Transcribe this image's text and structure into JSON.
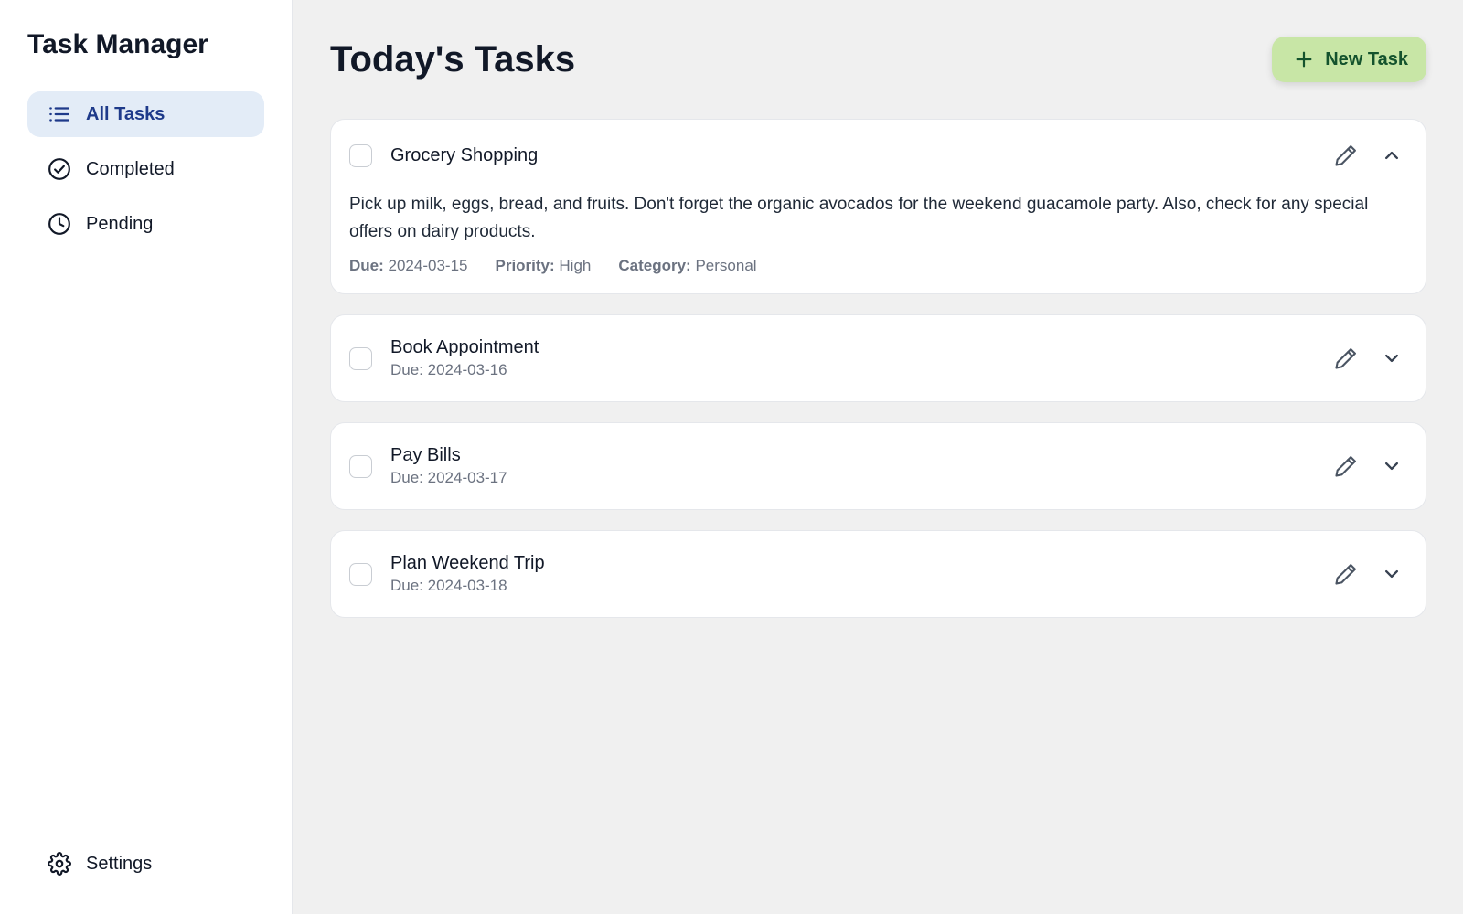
{
  "sidebar": {
    "title": "Task Manager",
    "nav": [
      {
        "label": "All Tasks",
        "icon": "list-icon",
        "active": true
      },
      {
        "label": "Completed",
        "icon": "check-circle-icon",
        "active": false
      },
      {
        "label": "Pending",
        "icon": "clock-icon",
        "active": false
      }
    ],
    "settings_label": "Settings"
  },
  "main": {
    "title": "Today's Tasks",
    "new_task_label": "New Task"
  },
  "tasks": [
    {
      "title": "Grocery Shopping",
      "expanded": true,
      "description": "Pick up milk, eggs, bread, and fruits. Don't forget the organic avocados for the weekend guacamole party. Also, check for any special offers on dairy products.",
      "due_label": "Due:",
      "due": "2024-03-15",
      "priority_label": "Priority:",
      "priority": "High",
      "category_label": "Category:",
      "category": "Personal"
    },
    {
      "title": "Book Appointment",
      "due_text": "Due: 2024-03-16"
    },
    {
      "title": "Pay Bills",
      "due_text": "Due: 2024-03-17"
    },
    {
      "title": "Plan Weekend Trip",
      "due_text": "Due: 2024-03-18"
    }
  ],
  "colors": {
    "accent_nav_bg": "#e3ecf7",
    "accent_nav_text": "#1e3a8a",
    "new_task_bg": "#c8e6a6",
    "new_task_text": "#14532d"
  }
}
